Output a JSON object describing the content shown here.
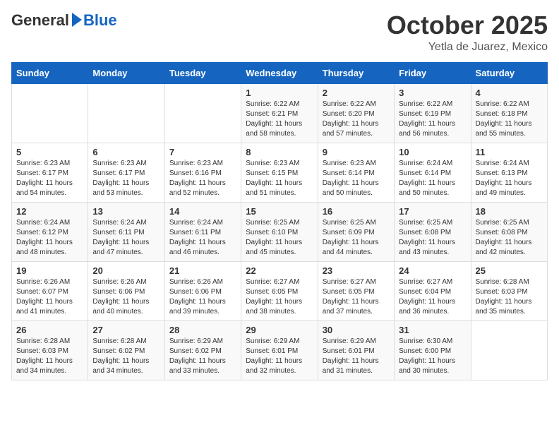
{
  "header": {
    "logo_general": "General",
    "logo_blue": "Blue",
    "month_title": "October 2025",
    "location": "Yetla de Juarez, Mexico"
  },
  "weekdays": [
    "Sunday",
    "Monday",
    "Tuesday",
    "Wednesday",
    "Thursday",
    "Friday",
    "Saturday"
  ],
  "weeks": [
    [
      {
        "day": "",
        "info": ""
      },
      {
        "day": "",
        "info": ""
      },
      {
        "day": "",
        "info": ""
      },
      {
        "day": "1",
        "info": "Sunrise: 6:22 AM\nSunset: 6:21 PM\nDaylight: 11 hours\nand 58 minutes."
      },
      {
        "day": "2",
        "info": "Sunrise: 6:22 AM\nSunset: 6:20 PM\nDaylight: 11 hours\nand 57 minutes."
      },
      {
        "day": "3",
        "info": "Sunrise: 6:22 AM\nSunset: 6:19 PM\nDaylight: 11 hours\nand 56 minutes."
      },
      {
        "day": "4",
        "info": "Sunrise: 6:22 AM\nSunset: 6:18 PM\nDaylight: 11 hours\nand 55 minutes."
      }
    ],
    [
      {
        "day": "5",
        "info": "Sunrise: 6:23 AM\nSunset: 6:17 PM\nDaylight: 11 hours\nand 54 minutes."
      },
      {
        "day": "6",
        "info": "Sunrise: 6:23 AM\nSunset: 6:17 PM\nDaylight: 11 hours\nand 53 minutes."
      },
      {
        "day": "7",
        "info": "Sunrise: 6:23 AM\nSunset: 6:16 PM\nDaylight: 11 hours\nand 52 minutes."
      },
      {
        "day": "8",
        "info": "Sunrise: 6:23 AM\nSunset: 6:15 PM\nDaylight: 11 hours\nand 51 minutes."
      },
      {
        "day": "9",
        "info": "Sunrise: 6:23 AM\nSunset: 6:14 PM\nDaylight: 11 hours\nand 50 minutes."
      },
      {
        "day": "10",
        "info": "Sunrise: 6:24 AM\nSunset: 6:14 PM\nDaylight: 11 hours\nand 50 minutes."
      },
      {
        "day": "11",
        "info": "Sunrise: 6:24 AM\nSunset: 6:13 PM\nDaylight: 11 hours\nand 49 minutes."
      }
    ],
    [
      {
        "day": "12",
        "info": "Sunrise: 6:24 AM\nSunset: 6:12 PM\nDaylight: 11 hours\nand 48 minutes."
      },
      {
        "day": "13",
        "info": "Sunrise: 6:24 AM\nSunset: 6:11 PM\nDaylight: 11 hours\nand 47 minutes."
      },
      {
        "day": "14",
        "info": "Sunrise: 6:24 AM\nSunset: 6:11 PM\nDaylight: 11 hours\nand 46 minutes."
      },
      {
        "day": "15",
        "info": "Sunrise: 6:25 AM\nSunset: 6:10 PM\nDaylight: 11 hours\nand 45 minutes."
      },
      {
        "day": "16",
        "info": "Sunrise: 6:25 AM\nSunset: 6:09 PM\nDaylight: 11 hours\nand 44 minutes."
      },
      {
        "day": "17",
        "info": "Sunrise: 6:25 AM\nSunset: 6:08 PM\nDaylight: 11 hours\nand 43 minutes."
      },
      {
        "day": "18",
        "info": "Sunrise: 6:25 AM\nSunset: 6:08 PM\nDaylight: 11 hours\nand 42 minutes."
      }
    ],
    [
      {
        "day": "19",
        "info": "Sunrise: 6:26 AM\nSunset: 6:07 PM\nDaylight: 11 hours\nand 41 minutes."
      },
      {
        "day": "20",
        "info": "Sunrise: 6:26 AM\nSunset: 6:06 PM\nDaylight: 11 hours\nand 40 minutes."
      },
      {
        "day": "21",
        "info": "Sunrise: 6:26 AM\nSunset: 6:06 PM\nDaylight: 11 hours\nand 39 minutes."
      },
      {
        "day": "22",
        "info": "Sunrise: 6:27 AM\nSunset: 6:05 PM\nDaylight: 11 hours\nand 38 minutes."
      },
      {
        "day": "23",
        "info": "Sunrise: 6:27 AM\nSunset: 6:05 PM\nDaylight: 11 hours\nand 37 minutes."
      },
      {
        "day": "24",
        "info": "Sunrise: 6:27 AM\nSunset: 6:04 PM\nDaylight: 11 hours\nand 36 minutes."
      },
      {
        "day": "25",
        "info": "Sunrise: 6:28 AM\nSunset: 6:03 PM\nDaylight: 11 hours\nand 35 minutes."
      }
    ],
    [
      {
        "day": "26",
        "info": "Sunrise: 6:28 AM\nSunset: 6:03 PM\nDaylight: 11 hours\nand 34 minutes."
      },
      {
        "day": "27",
        "info": "Sunrise: 6:28 AM\nSunset: 6:02 PM\nDaylight: 11 hours\nand 34 minutes."
      },
      {
        "day": "28",
        "info": "Sunrise: 6:29 AM\nSunset: 6:02 PM\nDaylight: 11 hours\nand 33 minutes."
      },
      {
        "day": "29",
        "info": "Sunrise: 6:29 AM\nSunset: 6:01 PM\nDaylight: 11 hours\nand 32 minutes."
      },
      {
        "day": "30",
        "info": "Sunrise: 6:29 AM\nSunset: 6:01 PM\nDaylight: 11 hours\nand 31 minutes."
      },
      {
        "day": "31",
        "info": "Sunrise: 6:30 AM\nSunset: 6:00 PM\nDaylight: 11 hours\nand 30 minutes."
      },
      {
        "day": "",
        "info": ""
      }
    ]
  ]
}
